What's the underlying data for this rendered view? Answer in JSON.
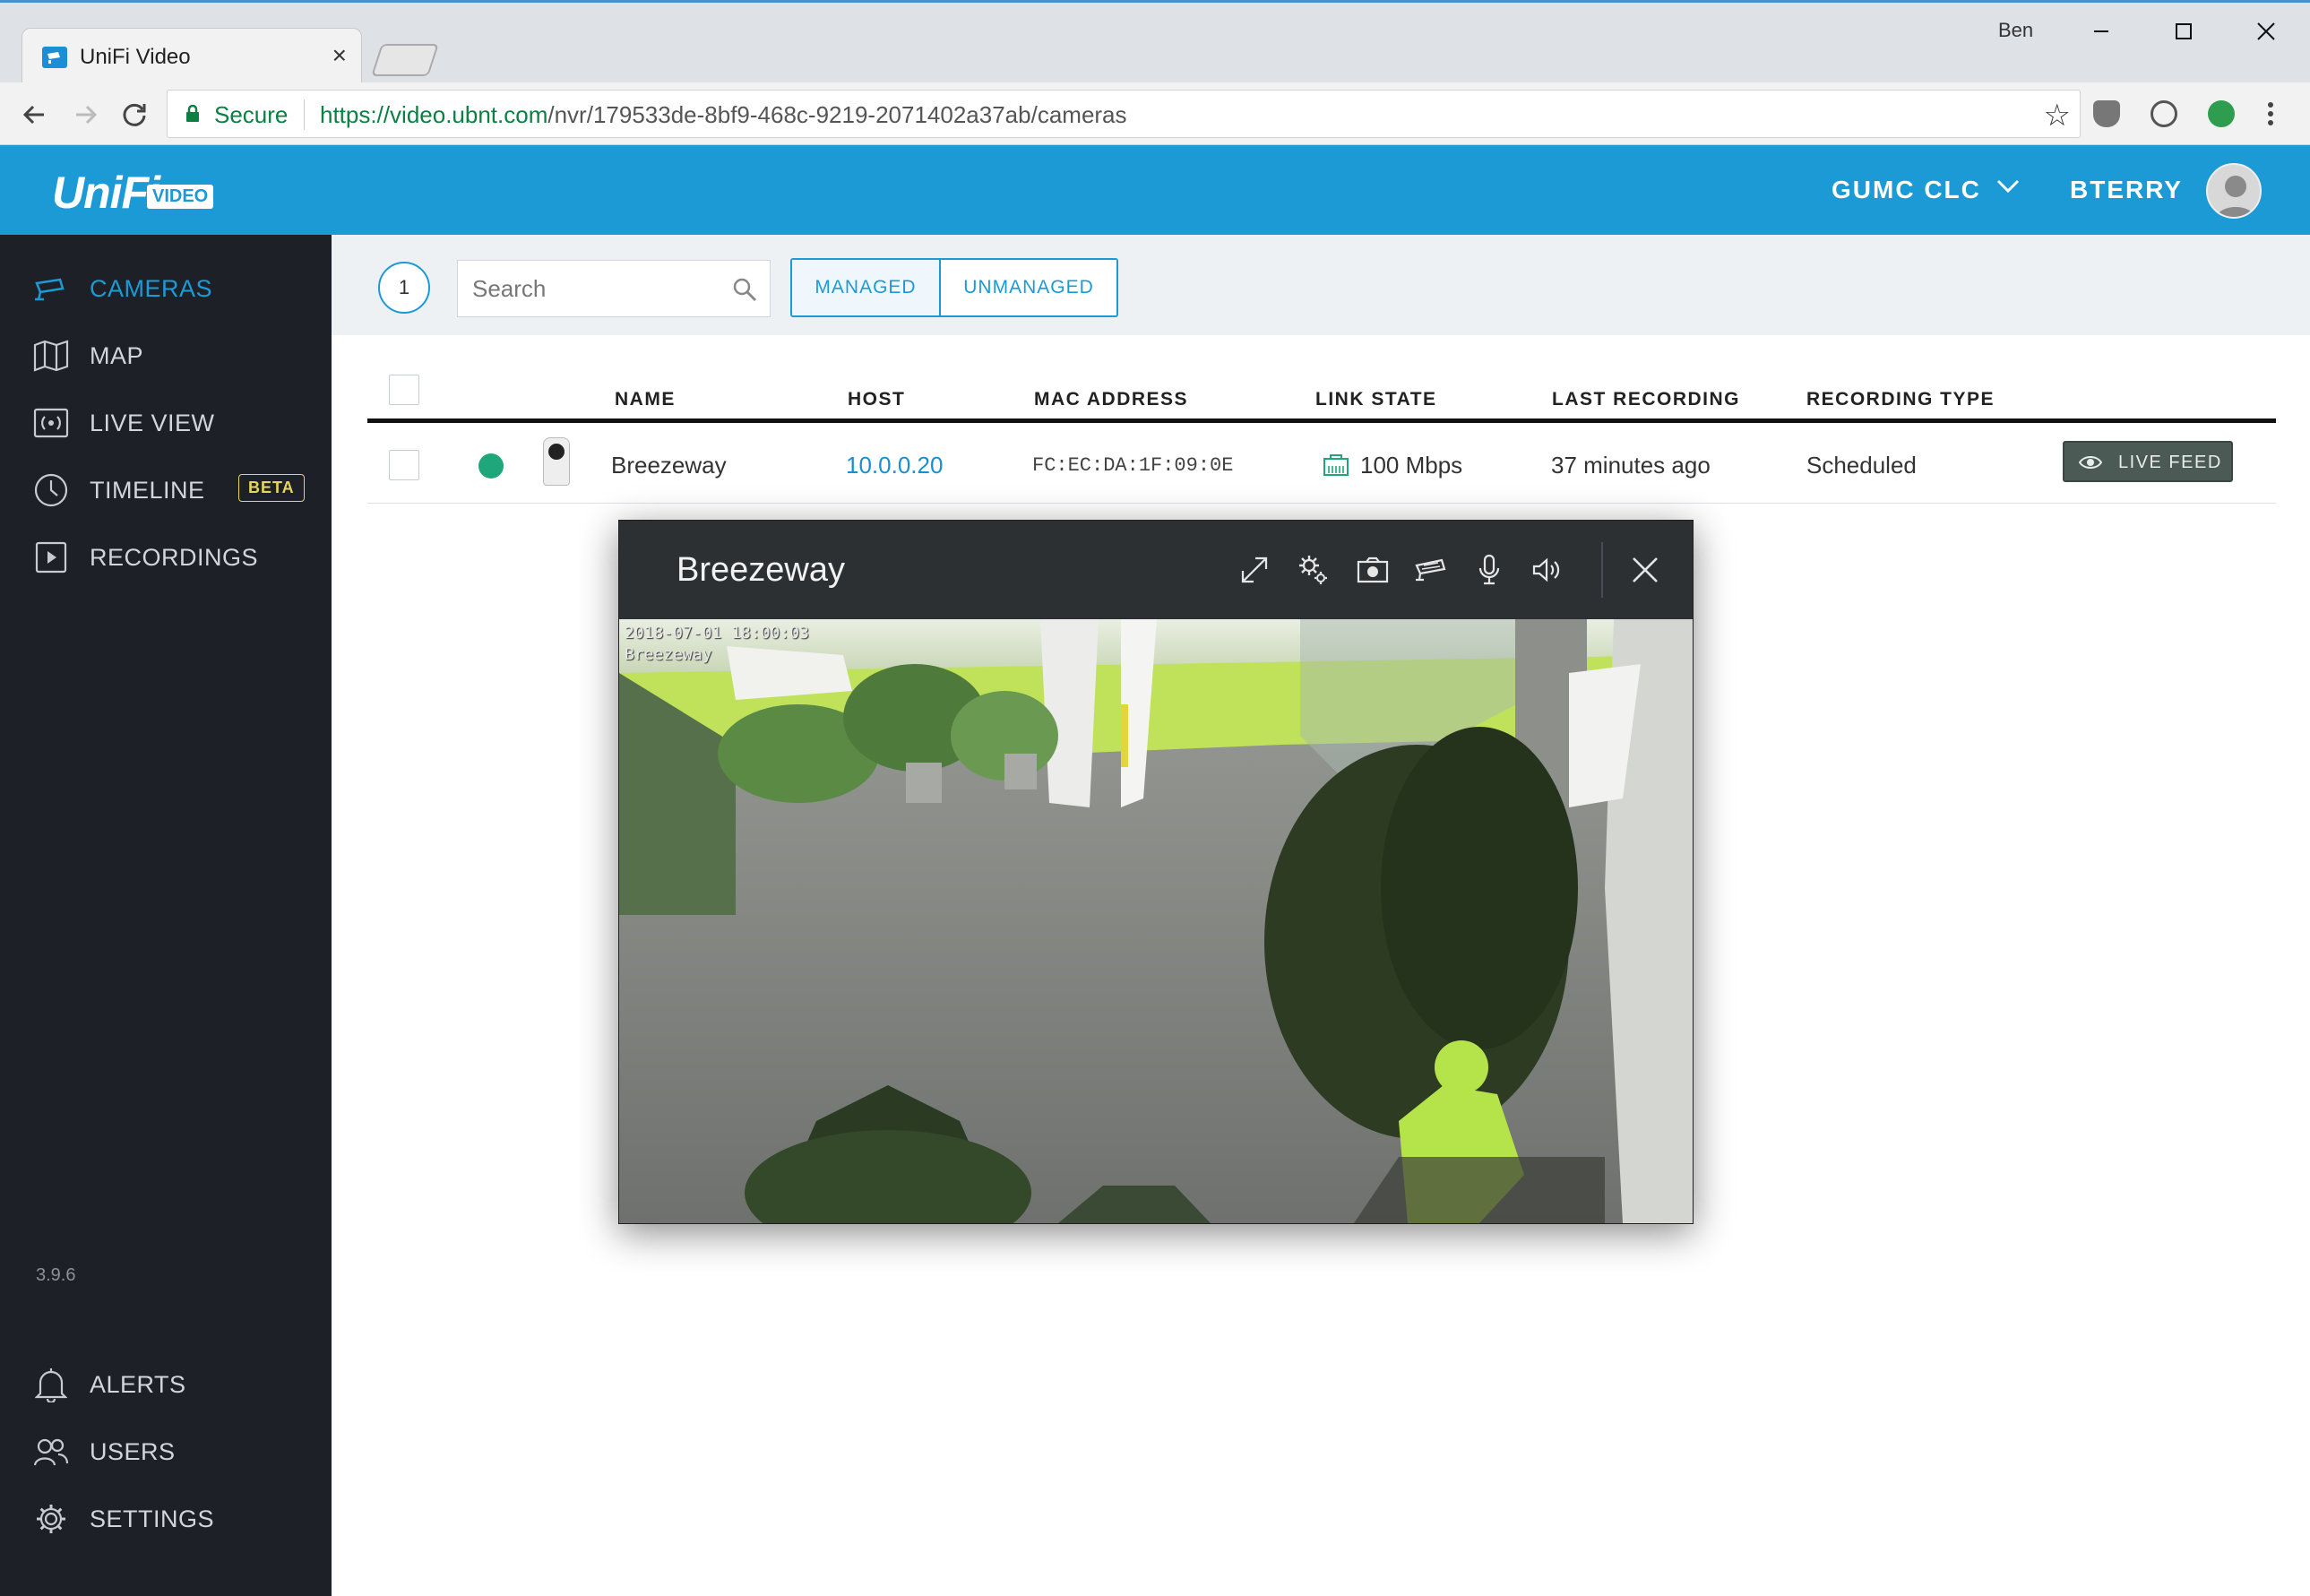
{
  "browser": {
    "tab_title": "UniFi Video",
    "tab_close": "×",
    "window_user": "Ben",
    "secure_label": "Secure",
    "url_host": "https://video.ubnt.com",
    "url_path": "/nvr/179533de-8bf9-468c-9219-2071402a37ab/cameras"
  },
  "header": {
    "logo_text": "UniFi",
    "logo_badge": "VIDEO",
    "site_name": "GUMC CLC",
    "user_name": "BTERRY"
  },
  "sidebar": {
    "items": [
      {
        "label": "CAMERAS",
        "icon": "camera-icon",
        "active": true
      },
      {
        "label": "MAP",
        "icon": "map-icon"
      },
      {
        "label": "LIVE VIEW",
        "icon": "live-view-icon"
      },
      {
        "label": "TIMELINE",
        "icon": "clock-icon",
        "badge": "BETA"
      },
      {
        "label": "RECORDINGS",
        "icon": "play-icon"
      }
    ],
    "version": "3.9.6",
    "bottom_items": [
      {
        "label": "ALERTS",
        "icon": "bell-icon"
      },
      {
        "label": "USERS",
        "icon": "users-icon"
      },
      {
        "label": "SETTINGS",
        "icon": "gear-icon"
      }
    ]
  },
  "filters": {
    "count": "1",
    "search_placeholder": "Search",
    "managed": "MANAGED",
    "unmanaged": "UNMANAGED"
  },
  "table": {
    "columns": [
      "NAME",
      "HOST",
      "MAC ADDRESS",
      "LINK STATE",
      "LAST RECORDING",
      "RECORDING TYPE"
    ],
    "rows": [
      {
        "status_color": "#1fa67a",
        "name": "Breezeway",
        "host": "10.0.0.20",
        "mac": "FC:EC:DA:1F:09:0E",
        "link_state": "100 Mbps",
        "last_recording": "37 minutes ago",
        "recording_type": "Scheduled",
        "action": "LIVE FEED"
      }
    ]
  },
  "modal": {
    "title": "Breezeway",
    "toolbar_icons": [
      "expand-icon",
      "settings-gears-icon",
      "snapshot-icon",
      "camera-icon",
      "microphone-icon",
      "speaker-icon",
      "close-icon"
    ],
    "osd_timestamp": "2018-07-01 18:00:03",
    "osd_name": "Breezeway"
  },
  "colors": {
    "accent": "#1b9ad6",
    "sidebar_bg": "#1d2127",
    "status_online": "#1fa67a",
    "beta_badge": "#e8d45a"
  }
}
